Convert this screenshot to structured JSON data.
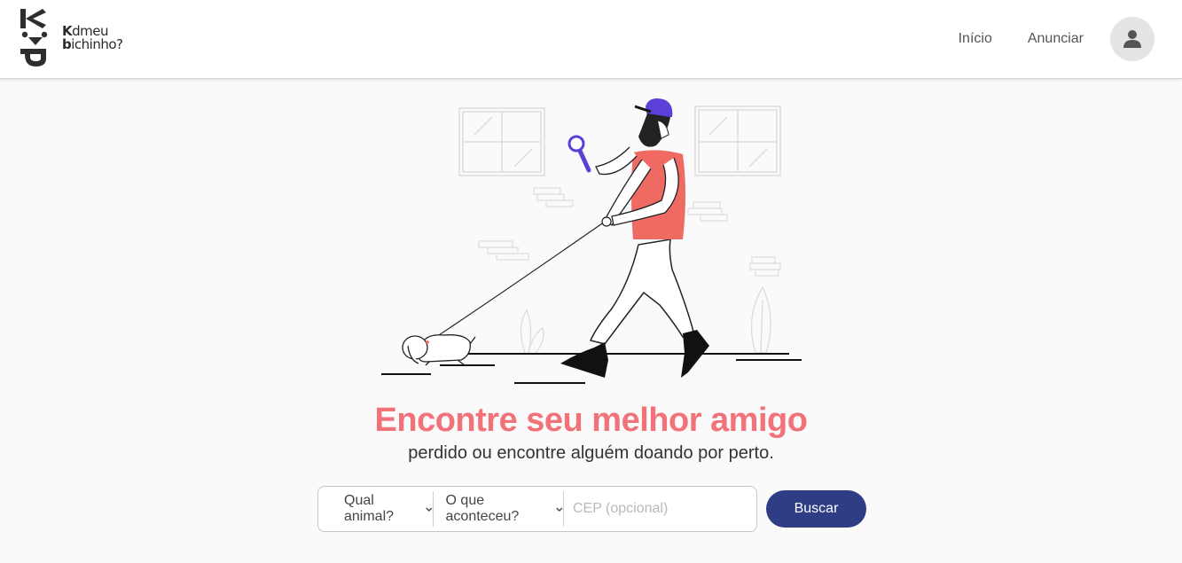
{
  "header": {
    "logo": {
      "line1_bold": "K",
      "line1_rest": "dmeu",
      "line2_bold": "b",
      "line2_rest": "ichinho?"
    },
    "nav": {
      "home": "Início",
      "announce": "Anunciar"
    },
    "avatar_icon": "user-icon"
  },
  "hero": {
    "illustration": "man-walking-dog-with-magnifier",
    "title": "Encontre seu melhor amigo",
    "subtitle": "perdido ou encontre alguém doando por perto."
  },
  "search": {
    "animal_label": "Qual animal?",
    "event_label": "O que aconteceu?",
    "cep_placeholder": "CEP (opcional)",
    "button_label": "Buscar"
  },
  "colors": {
    "accent": "#f2727a",
    "primary": "#2e3d84",
    "cap": "#5b3fd6",
    "shirt": "#ee6a62"
  }
}
